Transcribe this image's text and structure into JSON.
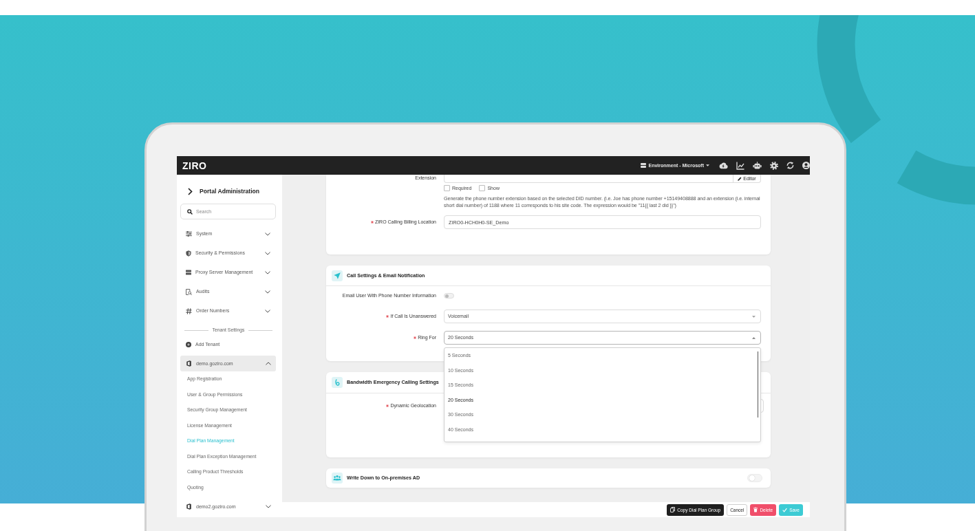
{
  "header": {
    "logo": "ZIRO",
    "environment": "Environment - Microsoft"
  },
  "sidebar": {
    "title": "Portal Administration",
    "search": {
      "placeholder": "Search"
    },
    "menu": [
      {
        "label": "System",
        "expanded": false
      },
      {
        "label": "Security & Permissions",
        "expanded": false
      },
      {
        "label": "Proxy Server Management",
        "expanded": false
      },
      {
        "label": "Audits",
        "expanded": false
      },
      {
        "label": "Order Numbers",
        "expanded": false
      }
    ],
    "tenant_heading": "Tenant Settings",
    "add_tenant": "Add Tenant",
    "tenants": [
      {
        "label": "demo.goziro.com",
        "expanded": true,
        "children": [
          {
            "label": "App Registration",
            "selected": false
          },
          {
            "label": "User & Group Permissions",
            "selected": false
          },
          {
            "label": "Security Group Management",
            "selected": false
          },
          {
            "label": "License Management",
            "selected": false
          },
          {
            "label": "Dial Plan Management",
            "selected": true
          },
          {
            "label": "Dial Plan Exception Management",
            "selected": false
          },
          {
            "label": "Calling Product Thresholds",
            "selected": false
          },
          {
            "label": "Quoting",
            "selected": false
          }
        ]
      },
      {
        "label": "demo2.goziro.com",
        "expanded": false
      }
    ]
  },
  "extension": {
    "label": "Extension",
    "editor_button": "Editor",
    "options": [
      {
        "label": "Required",
        "checked": false
      },
      {
        "label": "Show",
        "checked": false
      }
    ],
    "help": "Generate the phone number extension based on the selected DID number. (i.e. Joe has phone number +15149408888 and an extension (i.e. internal short dial number) of 1188 where 11 corresponds to his site code. The expression would be \"11{{ last 2 did }}\")"
  },
  "billing_location": {
    "label": "ZIRO Calling Billing Location",
    "required": true,
    "value": "ZIRO0-HCH0H0-SE_Demo"
  },
  "sections": [
    {
      "title": "Call Settings & Email Notification",
      "fields": [
        {
          "kind": "toggle",
          "label": "Email User With Phone Number Information",
          "required": false,
          "on": false
        },
        {
          "kind": "select",
          "label": "If Call Is Unanswered",
          "required": true,
          "value": "Voicemail",
          "open": false
        },
        {
          "kind": "select",
          "label": "Ring For",
          "required": true,
          "value": "20 Seconds",
          "open": true,
          "options": [
            {
              "label": "5 Seconds",
              "selected": false
            },
            {
              "label": "10 Seconds",
              "selected": false
            },
            {
              "label": "15 Seconds",
              "selected": false
            },
            {
              "label": "20 Seconds",
              "selected": true
            },
            {
              "label": "30 Seconds",
              "selected": false
            },
            {
              "label": "40 Seconds",
              "selected": false
            }
          ]
        }
      ]
    },
    {
      "title": "Bandwidth Emergency Calling Settings",
      "fields": [
        {
          "kind": "input",
          "label": "Dynamic Geolocation",
          "required": true
        }
      ]
    },
    {
      "title": "Write Down to On-premises AD",
      "toggle": {
        "on": false
      }
    }
  ],
  "actions": [
    {
      "kind": "copy",
      "label": "Copy Dial Plan Group"
    },
    {
      "kind": "cancel",
      "label": "Cancel"
    },
    {
      "kind": "delete",
      "label": "Delete"
    },
    {
      "kind": "save",
      "label": "Save"
    }
  ]
}
